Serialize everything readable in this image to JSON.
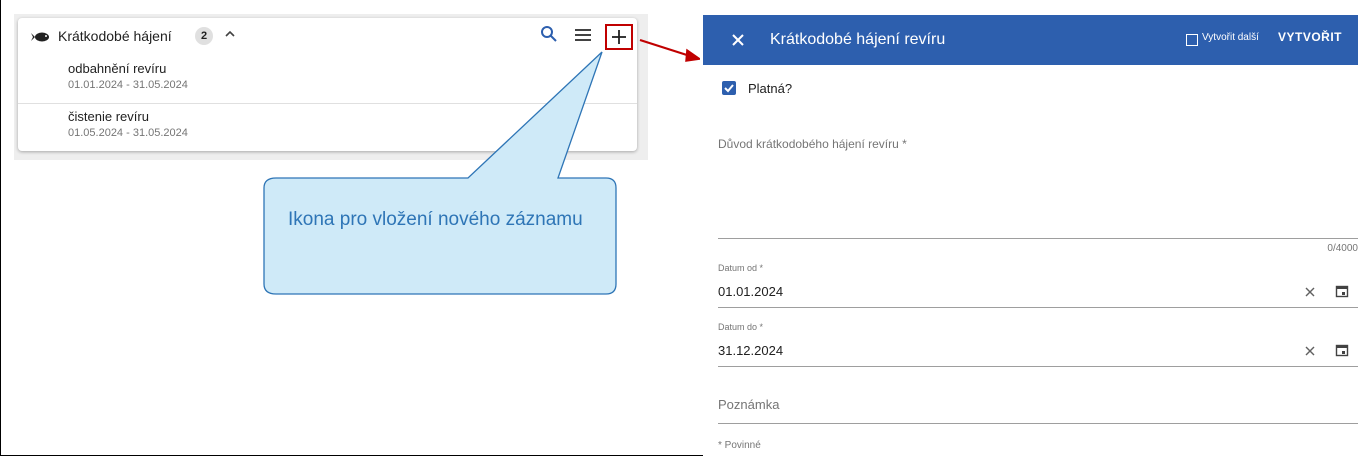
{
  "list": {
    "title": "Krátkodobé hájení",
    "count": "2",
    "items": [
      {
        "title": "odbahnění revíru",
        "dates": "01.01.2024 - 31.05.2024"
      },
      {
        "title": "čistenie revíru",
        "dates": "01.05.2024 - 31.05.2024"
      }
    ],
    "icons": [
      "fish-icon",
      "chevron-up-icon",
      "search-icon",
      "menu-icon",
      "plus-icon"
    ]
  },
  "callout": {
    "text": "Ikona pro vložení nového záznamu"
  },
  "dialog": {
    "title": "Krátkodobé hájení revíru",
    "create_another_label": "Vytvořit další",
    "create_another_checked": false,
    "create_label": "VYTVOŘIT",
    "valid_label": "Platná?",
    "valid_checked": true,
    "reason_label": "Důvod krátkodobého hájení revíru *",
    "reason_counter": "0/4000",
    "date_from": {
      "label": "Datum od *",
      "value": "01.01.2024"
    },
    "date_to": {
      "label": "Datum do *",
      "value": "31.12.2024"
    },
    "note_label": "Poznámka",
    "required_note": "* Povinné"
  },
  "colors": {
    "header": "#2d5fae",
    "highlight": "#c00000",
    "callout_fill": "#cfeaf8",
    "callout_border": "#2e75b6"
  }
}
